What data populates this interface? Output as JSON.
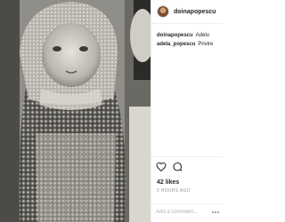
{
  "post": {
    "username": "doinapopescu",
    "image_alt": "Black-and-white photo of a baby in a knitted hat"
  },
  "comments": [
    {
      "user": "doinapopescu",
      "text": "Adelu"
    },
    {
      "user": "adela_popescu",
      "text": "Privire"
    }
  ],
  "stats": {
    "likes": "42 likes",
    "timestamp": "2 HOURS AGO"
  },
  "comment_box": {
    "placeholder": "Add a comment..."
  },
  "icons": [
    "heart-icon",
    "comment-icon",
    "more-options-icon"
  ]
}
